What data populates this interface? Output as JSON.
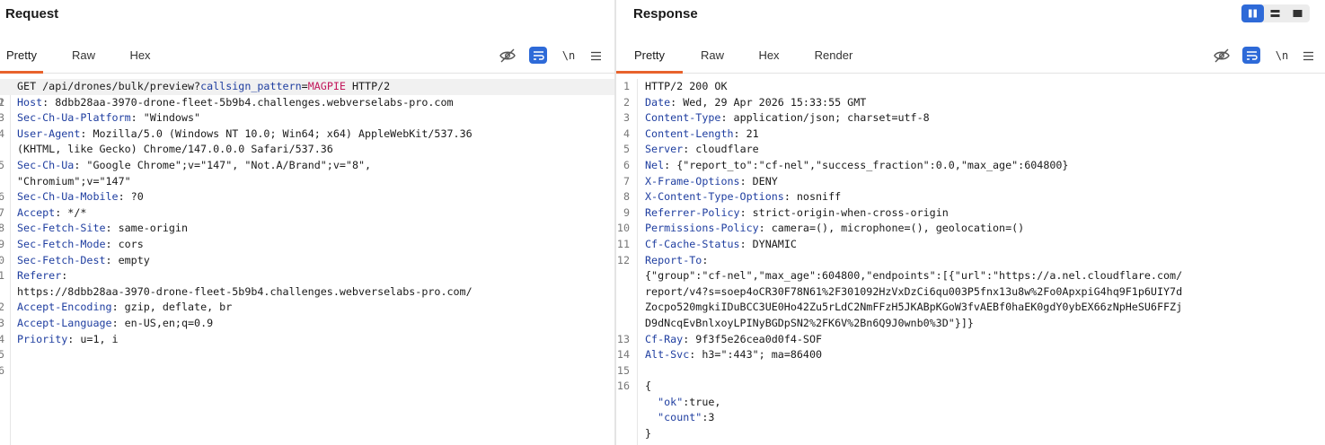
{
  "request": {
    "title": "Request",
    "tabs": [
      "Pretty",
      "Raw",
      "Hex"
    ],
    "active_tab": "Pretty",
    "newline_label": "\\n",
    "first_line": {
      "method_path": "GET /api/drones/bulk/preview?",
      "param_name": "callsign_pattern",
      "equals": "=",
      "param_value": "MAGPIE",
      "version": " HTTP/2"
    },
    "lines": [
      {
        "n": "1",
        "key": "",
        "value": ""
      },
      {
        "n": "2",
        "key": "Host",
        "value": ": 8dbb28aa-3970-drone-fleet-5b9b4.challenges.webverselabs-pro.com"
      },
      {
        "n": "3",
        "key": "Sec-Ch-Ua-Platform",
        "value": ": \"Windows\""
      },
      {
        "n": "4",
        "key": "User-Agent",
        "value": ": Mozilla/5.0 (Windows NT 10.0; Win64; x64) AppleWebKit/537.36"
      },
      {
        "n": "",
        "key": "",
        "value": "(KHTML, like Gecko) Chrome/147.0.0.0 Safari/537.36"
      },
      {
        "n": "5",
        "key": "Sec-Ch-Ua",
        "value": ": \"Google Chrome\";v=\"147\", \"Not.A/Brand\";v=\"8\","
      },
      {
        "n": "",
        "key": "",
        "value": "\"Chromium\";v=\"147\""
      },
      {
        "n": "6",
        "key": "Sec-Ch-Ua-Mobile",
        "value": ": ?0"
      },
      {
        "n": "7",
        "key": "Accept",
        "value": ": */*"
      },
      {
        "n": "8",
        "key": "Sec-Fetch-Site",
        "value": ": same-origin"
      },
      {
        "n": "9",
        "key": "Sec-Fetch-Mode",
        "value": ": cors"
      },
      {
        "n": "0",
        "key": "Sec-Fetch-Dest",
        "value": ": empty"
      },
      {
        "n": "1",
        "key": "Referer",
        "value": ":"
      },
      {
        "n": "",
        "key": "",
        "value": "https://8dbb28aa-3970-drone-fleet-5b9b4.challenges.webverselabs-pro.com/"
      },
      {
        "n": "2",
        "key": "Accept-Encoding",
        "value": ": gzip, deflate, br"
      },
      {
        "n": "3",
        "key": "Accept-Language",
        "value": ": en-US,en;q=0.9"
      },
      {
        "n": "4",
        "key": "Priority",
        "value": ": u=1, i"
      },
      {
        "n": "5",
        "key": "",
        "value": ""
      },
      {
        "n": "6",
        "key": "",
        "value": ""
      }
    ]
  },
  "response": {
    "title": "Response",
    "tabs": [
      "Pretty",
      "Raw",
      "Hex",
      "Render"
    ],
    "active_tab": "Pretty",
    "newline_label": "\\n",
    "lines": [
      {
        "n": "1",
        "key": "",
        "value": "HTTP/2 200 OK"
      },
      {
        "n": "2",
        "key": "Date",
        "value": ": Wed, 29 Apr 2026 15:33:55 GMT"
      },
      {
        "n": "3",
        "key": "Content-Type",
        "value": ": application/json; charset=utf-8"
      },
      {
        "n": "4",
        "key": "Content-Length",
        "value": ": 21"
      },
      {
        "n": "5",
        "key": "Server",
        "value": ": cloudflare"
      },
      {
        "n": "6",
        "key": "Nel",
        "value": ": {\"report_to\":\"cf-nel\",\"success_fraction\":0.0,\"max_age\":604800}"
      },
      {
        "n": "7",
        "key": "X-Frame-Options",
        "value": ": DENY"
      },
      {
        "n": "8",
        "key": "X-Content-Type-Options",
        "value": ": nosniff"
      },
      {
        "n": "9",
        "key": "Referrer-Policy",
        "value": ": strict-origin-when-cross-origin"
      },
      {
        "n": "10",
        "key": "Permissions-Policy",
        "value": ": camera=(), microphone=(), geolocation=()"
      },
      {
        "n": "11",
        "key": "Cf-Cache-Status",
        "value": ": DYNAMIC"
      },
      {
        "n": "12",
        "key": "Report-To",
        "value": ":"
      },
      {
        "n": "",
        "key": "",
        "value": "{\"group\":\"cf-nel\",\"max_age\":604800,\"endpoints\":[{\"url\":\"https://a.nel.cloudflare.com/"
      },
      {
        "n": "",
        "key": "",
        "value": "report/v4?s=soep4oCR30F78N61%2F301092HzVxDzCi6qu003P5fnx13u8w%2Fo0ApxpiG4hq9F1p6UIY7d"
      },
      {
        "n": "",
        "key": "",
        "value": "Zocpo520mgkiIDuBCC3UE0Ho42Zu5rLdC2NmFFzH5JKABpKGoW3fvAEBf0haEK0gdY0ybEX66zNpHeSU6FFZj"
      },
      {
        "n": "",
        "key": "",
        "value": "D9dNcqEvBnlxoyLPINyBGDpSN2%2FK6V%2Bn6Q9J0wnb0%3D\"}]}"
      },
      {
        "n": "13",
        "key": "Cf-Ray",
        "value": ": 9f3f5e26cea0d0f4-SOF"
      },
      {
        "n": "14",
        "key": "Alt-Svc",
        "value": ": h3=\":443\"; ma=86400"
      },
      {
        "n": "15",
        "key": "",
        "value": ""
      },
      {
        "n": "16",
        "key": "",
        "value": "{"
      },
      {
        "n": "",
        "key": "",
        "value": "",
        "json_key": "\"ok\"",
        "json_val": ":true,"
      },
      {
        "n": "",
        "key": "",
        "value": "",
        "json_key": "\"count\"",
        "json_val": ":3"
      },
      {
        "n": "",
        "key": "",
        "value": "}"
      }
    ]
  }
}
